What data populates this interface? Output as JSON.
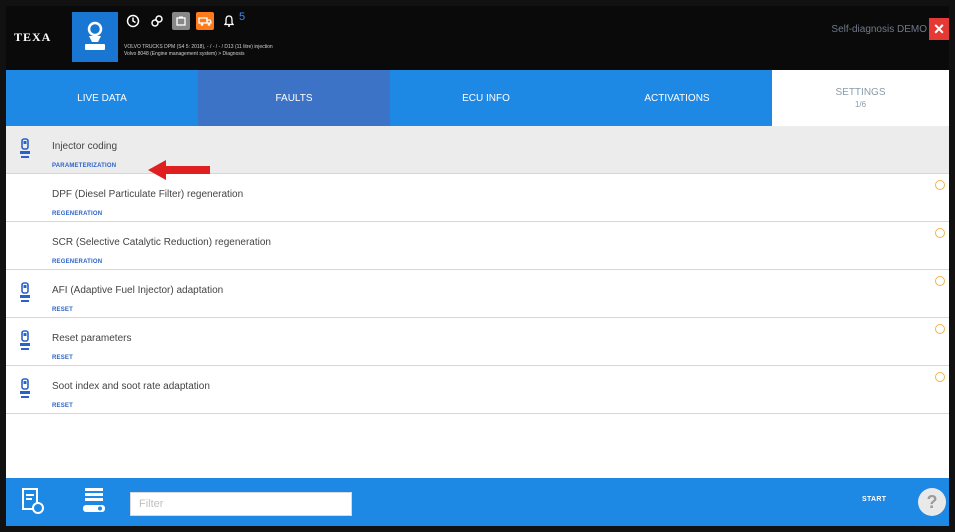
{
  "header": {
    "logo_text": "TEXA",
    "notification_count": "5",
    "vehicle_line1": "VOLVO TRUCKS DPM (S4 5: 2018), - / - / - / D13 (11 litre) injection",
    "vehicle_line2": "Volvo 8048 (Engine management system) > Diagnosis",
    "mode_label": "Self-diagnosis DEMO",
    "close_glyph": "×"
  },
  "tabs": [
    {
      "label": "LIVE DATA",
      "sub": ""
    },
    {
      "label": "FAULTS",
      "sub": ""
    },
    {
      "label": "ECU INFO",
      "sub": ""
    },
    {
      "label": "ACTIVATIONS",
      "sub": ""
    },
    {
      "label": "SETTINGS",
      "sub": "1/6"
    }
  ],
  "rows": [
    {
      "title": "Injector coding",
      "category": "PARAMETERIZATION"
    },
    {
      "title": "DPF (Diesel Particulate Filter) regeneration",
      "category": "REGENERATION"
    },
    {
      "title": "SCR (Selective Catalytic Reduction) regeneration",
      "category": "REGENERATION"
    },
    {
      "title": "AFI (Adaptive Fuel Injector) adaptation",
      "category": "RESET"
    },
    {
      "title": "Reset parameters",
      "category": "RESET"
    },
    {
      "title": "Soot index and soot rate adaptation",
      "category": "RESET"
    }
  ],
  "footer": {
    "filter_placeholder": "Filter",
    "start_label": "START",
    "help_glyph": "?"
  },
  "colors": {
    "accent": "#1e88e5",
    "selected_tab": "#3d73c7",
    "category_text": "#2c63c9",
    "close": "#e53935",
    "arrow": "#e02020",
    "warning": "#f2b44a"
  },
  "icons": {
    "vehicle": "vehicle-person-icon",
    "clock": "clock-icon",
    "link": "link-icon",
    "battery": "battery-icon",
    "truck": "truck-icon",
    "bell": "bell-icon",
    "injector": "injector-icon",
    "warning": "warning-icon",
    "report": "report-icon",
    "ecu": "ecu-icon",
    "help": "help-icon"
  }
}
